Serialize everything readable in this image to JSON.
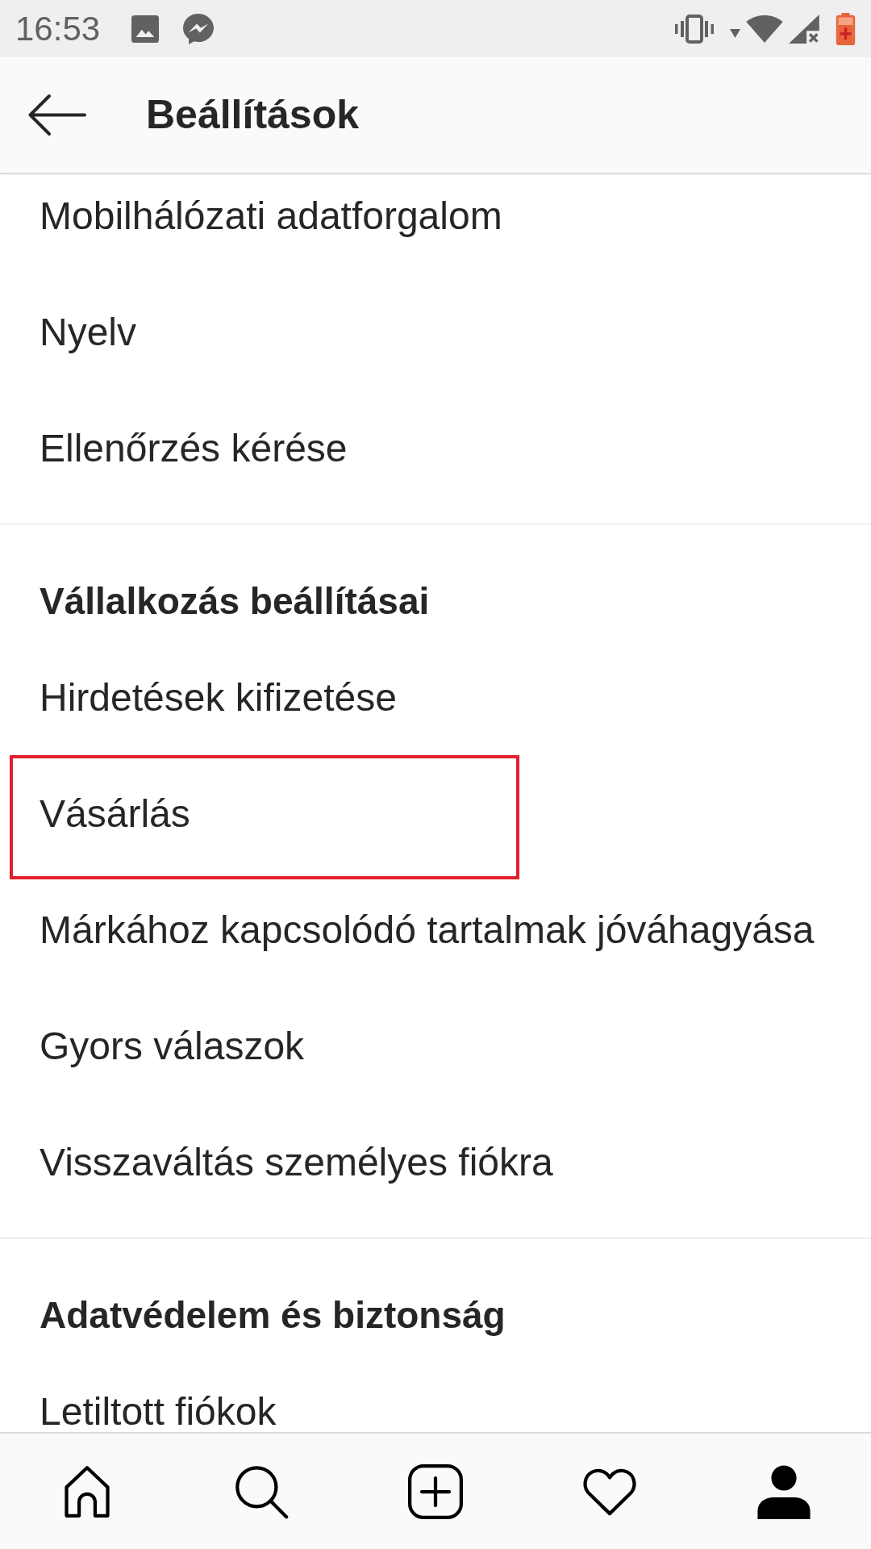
{
  "status_bar": {
    "time": "16:53"
  },
  "header": {
    "title": "Beállítások"
  },
  "groups": [
    {
      "items": [
        {
          "label": "Mobilhálózati adatforgalom",
          "highlighted": false
        },
        {
          "label": "Nyelv",
          "highlighted": false
        },
        {
          "label": "Ellenőrzés kérése",
          "highlighted": false
        }
      ]
    },
    {
      "heading": "Vállalkozás beállításai",
      "items": [
        {
          "label": "Hirdetések kifizetése",
          "highlighted": false
        },
        {
          "label": "Vásárlás",
          "highlighted": true
        },
        {
          "label": "Márkához kapcsolódó tartalmak jóváhagyása",
          "highlighted": false
        },
        {
          "label": "Gyors válaszok",
          "highlighted": false
        },
        {
          "label": "Visszaváltás személyes fiókra",
          "highlighted": false
        }
      ]
    },
    {
      "heading": "Adatvédelem és biztonság",
      "items": [
        {
          "label": "Letiltott fiókok",
          "highlighted": false
        }
      ]
    }
  ],
  "bottom_nav": [
    {
      "kind": "home",
      "selected": false
    },
    {
      "kind": "search",
      "selected": false
    },
    {
      "kind": "add",
      "selected": false
    },
    {
      "kind": "activity",
      "selected": false
    },
    {
      "kind": "profile",
      "selected": true
    }
  ]
}
